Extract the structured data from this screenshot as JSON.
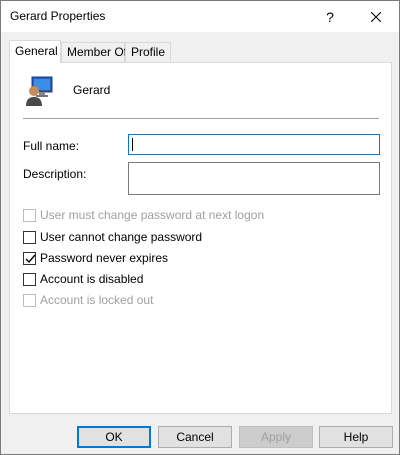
{
  "window": {
    "title": "Gerard Properties",
    "help_symbol": "?"
  },
  "tabs": [
    {
      "label": "General",
      "active": true
    },
    {
      "label": "Member Of",
      "active": false
    },
    {
      "label": "Profile",
      "active": false
    }
  ],
  "general": {
    "user_display_name": "Gerard",
    "user_icon": "user-computer-icon",
    "full_name_label": "Full name:",
    "full_name_value": "",
    "description_label": "Description:",
    "description_value": "",
    "checkboxes": [
      {
        "label": "User must change password at next logon",
        "checked": false,
        "enabled": false
      },
      {
        "label": "User cannot change password",
        "checked": false,
        "enabled": true
      },
      {
        "label": "Password never expires",
        "checked": true,
        "enabled": true
      },
      {
        "label": "Account is disabled",
        "checked": false,
        "enabled": true
      },
      {
        "label": "Account is locked out",
        "checked": false,
        "enabled": false
      }
    ]
  },
  "buttons": {
    "ok": "OK",
    "cancel": "Cancel",
    "apply": "Apply",
    "help": "Help"
  },
  "colors": {
    "focus_border": "#0078d7",
    "disabled_text": "#a0a0a0"
  }
}
